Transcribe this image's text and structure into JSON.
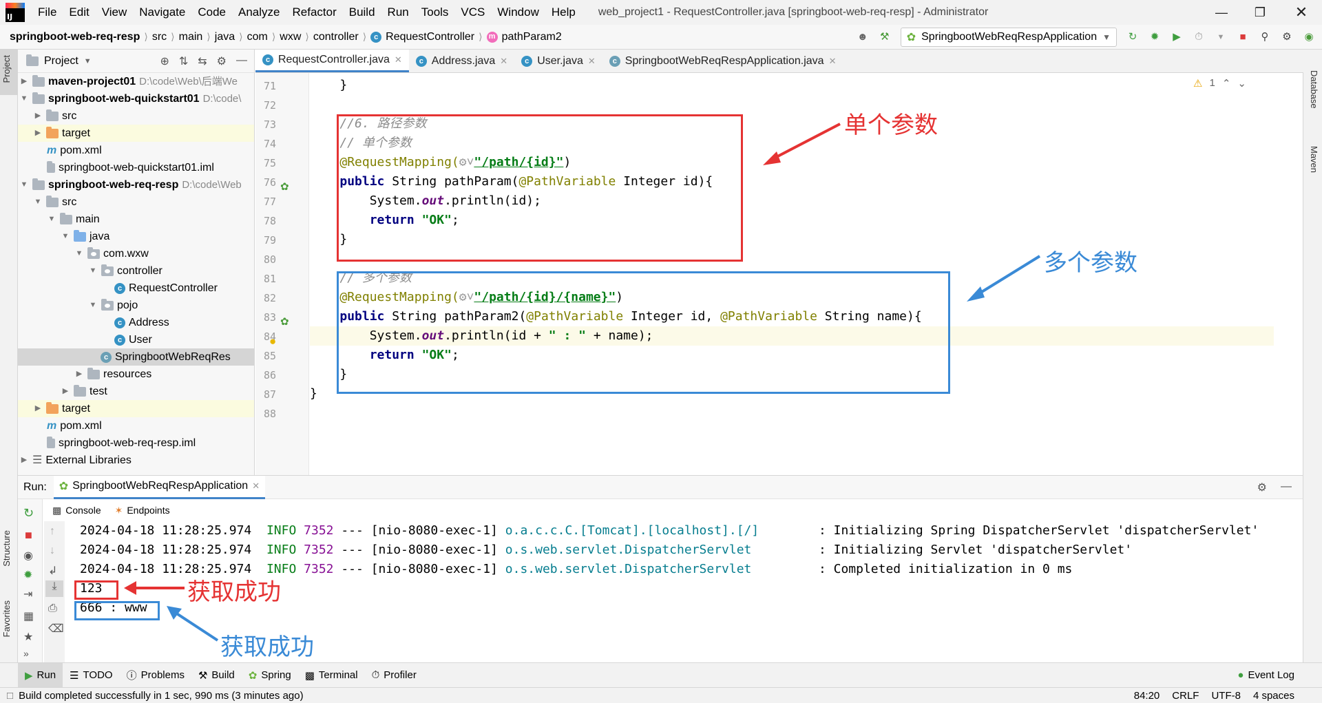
{
  "menu": {
    "items": [
      "File",
      "Edit",
      "View",
      "Navigate",
      "Code",
      "Analyze",
      "Refactor",
      "Build",
      "Run",
      "Tools",
      "VCS",
      "Window",
      "Help"
    ],
    "window_title": "web_project1 - RequestController.java [springboot-web-req-resp] - Administrator"
  },
  "nav": {
    "crumbs": [
      "springboot-web-req-resp",
      "src",
      "main",
      "java",
      "com",
      "wxw",
      "controller",
      "RequestController",
      "pathParam2"
    ],
    "run_config": "SpringbootWebReqRespApplication"
  },
  "project": {
    "title": "Project",
    "tree": [
      {
        "label": "maven-project01",
        "path": "D:\\code\\Web\\后端We",
        "bold": true
      },
      {
        "label": "springboot-web-quickstart01",
        "path": "D:\\code\\",
        "bold": true
      },
      {
        "label": "src"
      },
      {
        "label": "target"
      },
      {
        "label": "pom.xml"
      },
      {
        "label": "springboot-web-quickstart01.iml"
      },
      {
        "label": "springboot-web-req-resp",
        "path": "D:\\code\\Web",
        "bold": true
      },
      {
        "label": "src"
      },
      {
        "label": "main"
      },
      {
        "label": "java"
      },
      {
        "label": "com.wxw"
      },
      {
        "label": "controller"
      },
      {
        "label": "RequestController"
      },
      {
        "label": "pojo"
      },
      {
        "label": "Address"
      },
      {
        "label": "User"
      },
      {
        "label": "SpringbootWebReqRes"
      },
      {
        "label": "resources"
      },
      {
        "label": "test"
      },
      {
        "label": "target"
      },
      {
        "label": "pom.xml"
      },
      {
        "label": "springboot-web-req-resp.iml"
      },
      {
        "label": "External Libraries"
      }
    ]
  },
  "editor": {
    "tabs": [
      "RequestController.java",
      "Address.java",
      "User.java",
      "SpringbootWebReqRespApplication.java"
    ],
    "line_numbers": [
      "71",
      "72",
      "73",
      "74",
      "75",
      "76",
      "77",
      "78",
      "79",
      "80",
      "81",
      "82",
      "83",
      "84",
      "85",
      "86",
      "87",
      "88"
    ],
    "warning_count": "1",
    "code": {
      "l71": "    }",
      "l73": "    //6. 路径参数",
      "l74": "    // 单个参数",
      "l75_ann": "@RequestMapping(",
      "l75_str": "\"/path/{id}\"",
      "l75_end": ")",
      "l76_kw": "public",
      "l76_rest": " String pathParam(",
      "l76_ann": "@PathVariable",
      "l76_end": " Integer id){",
      "l77_a": "        System.",
      "l77_out": "out",
      "l77_b": ".println(id);",
      "l78_kw": "return",
      "l78_str": "\"OK\"",
      "l78_end": ";",
      "l79": "    }",
      "l81": "    // 多个参数",
      "l82_ann": "@RequestMapping(",
      "l82_str": "\"/path/{id}/{name}\"",
      "l82_end": ")",
      "l83_kw": "public",
      "l83_rest": " String pathParam2(",
      "l83_ann1": "@PathVariable",
      "l83_mid": " Integer id, ",
      "l83_ann2": "@PathVariable",
      "l83_end": " String name){",
      "l84_a": "        System.",
      "l84_out": "out",
      "l84_b": ".println(id + ",
      "l84_str1": "\" : \"",
      "l84_c": " + name);",
      "l85_kw": "return",
      "l85_str": "\"OK\"",
      "l85_end": ";",
      "l86": "    }",
      "l87": "}"
    }
  },
  "annotations": {
    "single": "单个参数",
    "multi": "多个参数",
    "success1": "获取成功",
    "success2": "获取成功"
  },
  "run": {
    "label": "Run:",
    "app": "SpringbootWebReqRespApplication",
    "console_tab": "Console",
    "endpoints_tab": "Endpoints",
    "logs": [
      {
        "ts": "2024-04-18 11:28:25.974",
        "level": "INFO",
        "pid": "7352",
        "thread": "--- [nio-8080-exec-1]",
        "logger": "o.a.c.c.C.[Tomcat].[localhost].[/]       ",
        "msg": ": Initializing Spring DispatcherServlet 'dispatcherServlet'"
      },
      {
        "ts": "2024-04-18 11:28:25.974",
        "level": "INFO",
        "pid": "7352",
        "thread": "--- [nio-8080-exec-1]",
        "logger": "o.s.web.servlet.DispatcherServlet        ",
        "msg": ": Initializing Servlet 'dispatcherServlet'"
      },
      {
        "ts": "2024-04-18 11:28:25.974",
        "level": "INFO",
        "pid": "7352",
        "thread": "--- [nio-8080-exec-1]",
        "logger": "o.s.web.servlet.DispatcherServlet        ",
        "msg": ": Completed initialization in 0 ms"
      }
    ],
    "out1": "123",
    "out2": "666 : www"
  },
  "bottom_tabs": [
    "Run",
    "TODO",
    "Problems",
    "Build",
    "Spring",
    "Terminal",
    "Profiler"
  ],
  "event_log": "Event Log",
  "status": {
    "message": "Build completed successfully in 1 sec, 990 ms (3 minutes ago)",
    "position": "84:20",
    "line_sep": "CRLF",
    "encoding": "UTF-8",
    "indent": "4 spaces"
  },
  "side_tabs": {
    "project": "Project",
    "structure": "Structure",
    "favorites": "Favorites",
    "database": "Database",
    "maven": "Maven"
  }
}
